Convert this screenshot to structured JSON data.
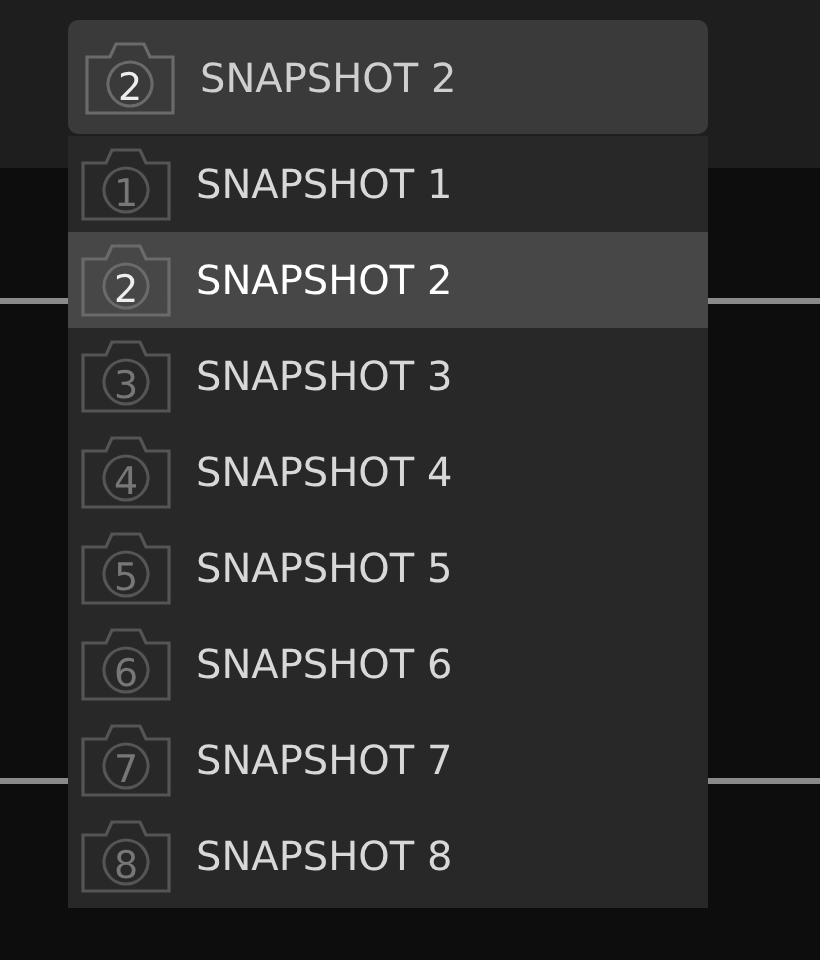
{
  "dropdown": {
    "number": "2",
    "label": "SNAPSHOT 2"
  },
  "items": [
    {
      "number": "1",
      "label": "SNAPSHOT 1",
      "selected": false
    },
    {
      "number": "2",
      "label": "SNAPSHOT 2",
      "selected": true
    },
    {
      "number": "3",
      "label": "SNAPSHOT 3",
      "selected": false
    },
    {
      "number": "4",
      "label": "SNAPSHOT 4",
      "selected": false
    },
    {
      "number": "5",
      "label": "SNAPSHOT 5",
      "selected": false
    },
    {
      "number": "6",
      "label": "SNAPSHOT 6",
      "selected": false
    },
    {
      "number": "7",
      "label": "SNAPSHOT 7",
      "selected": false
    },
    {
      "number": "8",
      "label": "SNAPSHOT 8",
      "selected": false
    }
  ]
}
